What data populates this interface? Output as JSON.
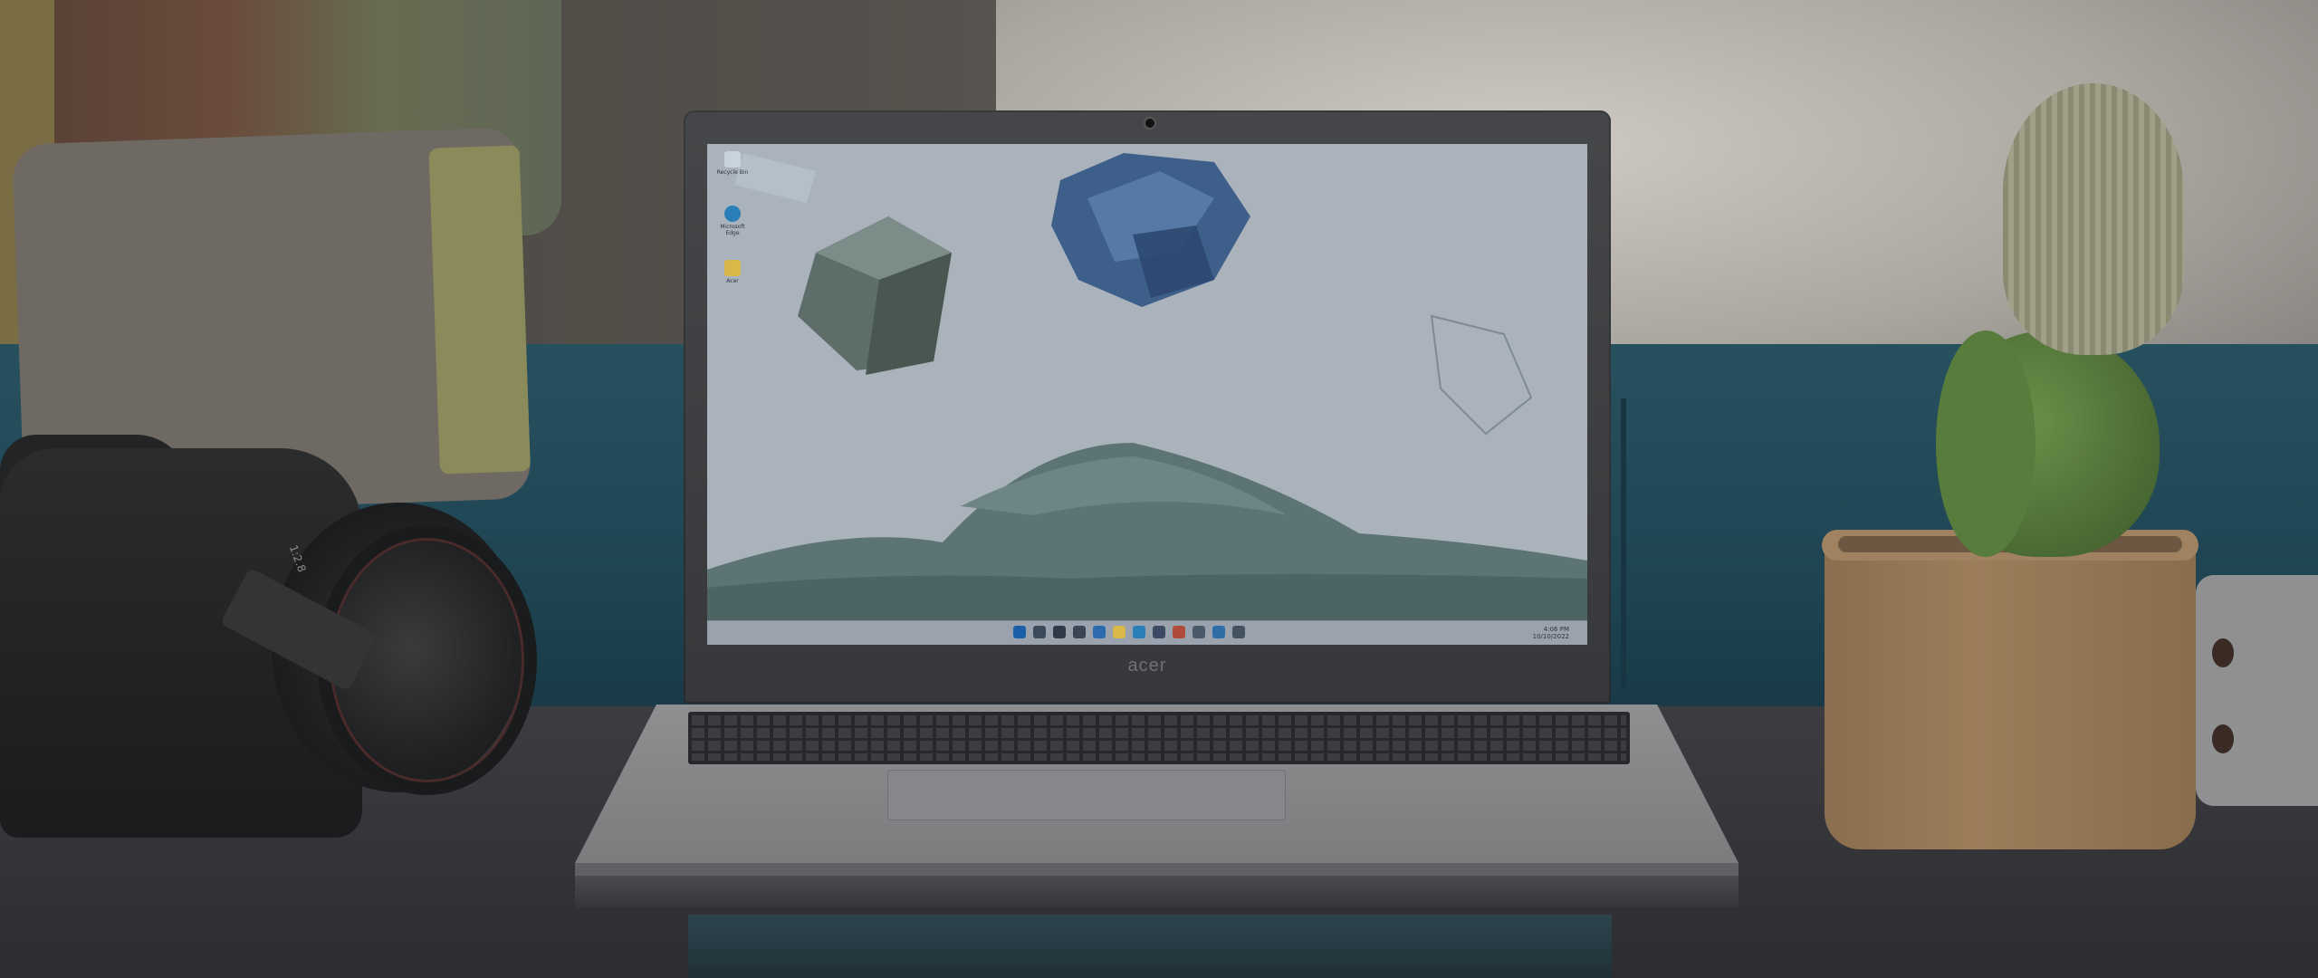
{
  "photo": {
    "description_visible_text": {
      "laptop_brand": "acer"
    },
    "desktop_icons": [
      {
        "name": "recycle-bin",
        "label": "Recycle Bin",
        "color": "#c9d3dc"
      },
      {
        "name": "edge",
        "label": "Microsoft Edge",
        "color": "#2a7fb8"
      },
      {
        "name": "folder",
        "label": "Acer",
        "color": "#d9b84a"
      }
    ],
    "taskbar_icon_colors": [
      "#1b5fa8",
      "#3d4a5a",
      "#2f3a48",
      "#3b4553",
      "#2c6bb0",
      "#d9b84a",
      "#2a7fb8",
      "#3c4a63",
      "#b04a3a",
      "#4b5a6a",
      "#2f6da6",
      "#44525e"
    ],
    "tray": {
      "time": "4:06 PM",
      "date": "10/10/2022"
    },
    "colors": {
      "sofa": "#1f4553",
      "lid": "#3a3b3e",
      "screen_tint": "#9aa5b0",
      "cactus_green": "#4f6f36",
      "pot": "#9c7d5a"
    },
    "camera_lens_text": "1:2.8"
  }
}
